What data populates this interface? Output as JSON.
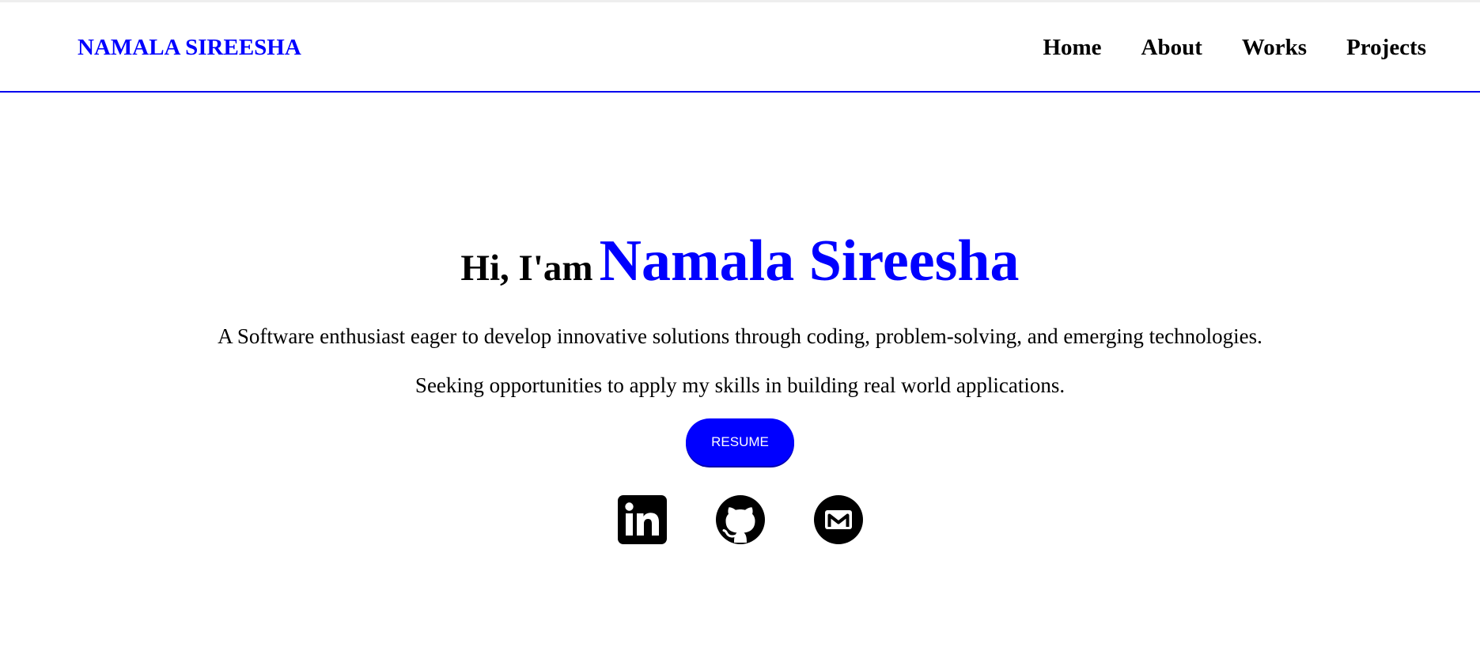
{
  "navbar": {
    "brand": "NAMALA SIREESHA",
    "links": [
      "Home",
      "About",
      "Works",
      "Projects"
    ]
  },
  "hero": {
    "greeting_prefix": "Hi, I'am",
    "name": "Namala Sireesha",
    "tagline": "A Software enthusiast eager to develop innovative solutions through coding, problem-solving, and emerging technologies.",
    "seeking": "Seeking opportunities to apply my skills in building real world applications.",
    "resume_label": "RESUME"
  },
  "socials": [
    {
      "icon": "linkedin-icon"
    },
    {
      "icon": "github-icon"
    },
    {
      "icon": "gmail-icon"
    }
  ],
  "colors": {
    "accent": "#0000ff",
    "text": "#000000",
    "background": "#ffffff"
  }
}
